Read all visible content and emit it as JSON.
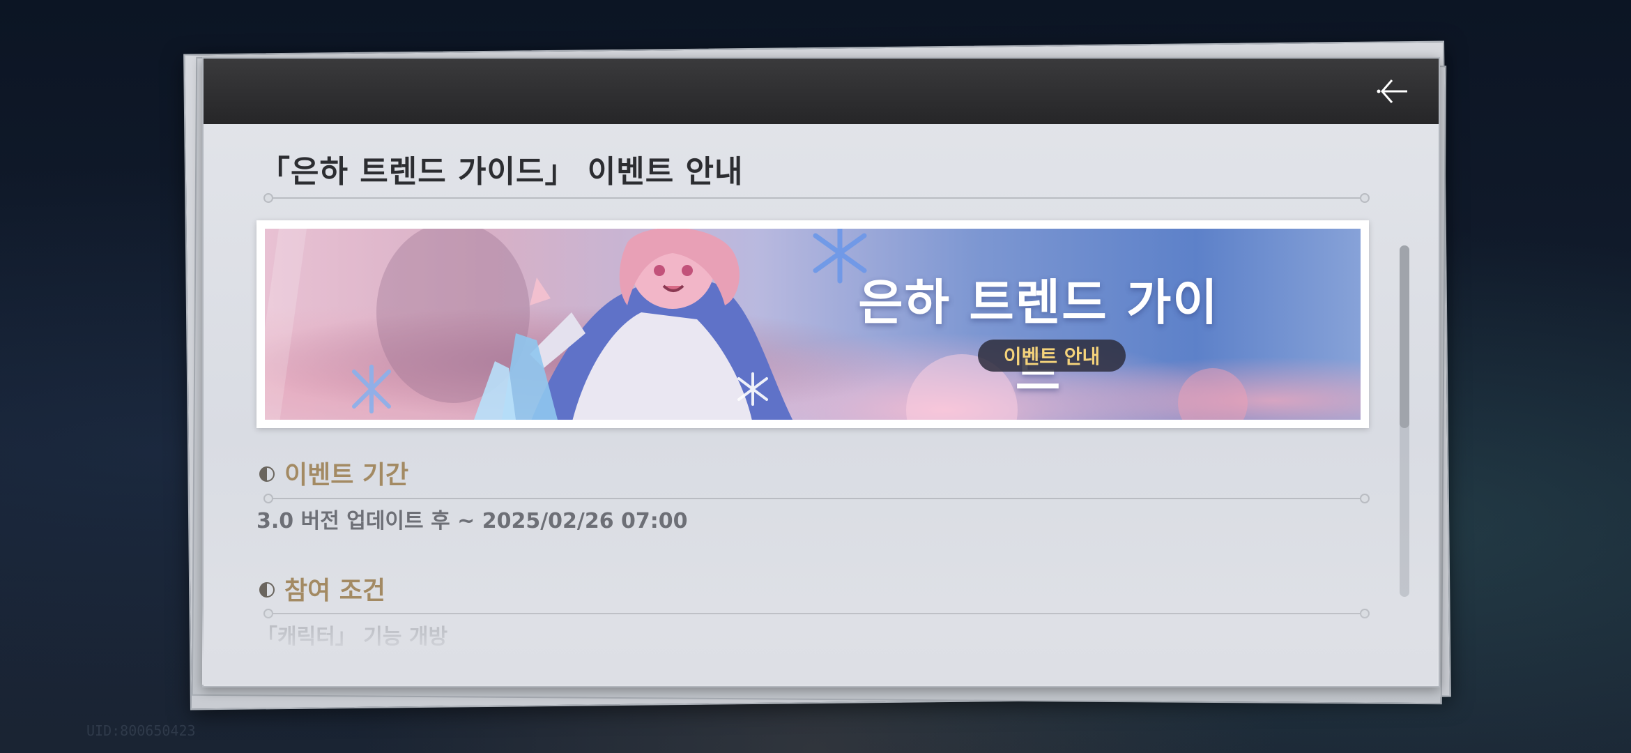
{
  "notice": {
    "title": "「은하 트렌드 가이드」 이벤트 안내",
    "back_icon": "back-arrow-icon"
  },
  "banner": {
    "title": "은하 트렌드 가이드",
    "subtitle": "이벤트 안내",
    "colors": {
      "pill_text": "#f5d37b",
      "pill_bg": "#2d2d3c"
    }
  },
  "sections": [
    {
      "heading": "이벤트 기간",
      "text": "3.0 버전 업데이트 후 ~ 2025/02/26 07:00"
    },
    {
      "heading": "참여 조건",
      "text": "「캐릭터」 기능 개방"
    }
  ],
  "scrollbar": {
    "thumb_fraction": 0.52
  },
  "footer": {
    "uid": "UID:800650423"
  },
  "colors": {
    "section_heading": "#a38a63",
    "title": "#2c2d31",
    "topbar": "#2e2e30"
  }
}
